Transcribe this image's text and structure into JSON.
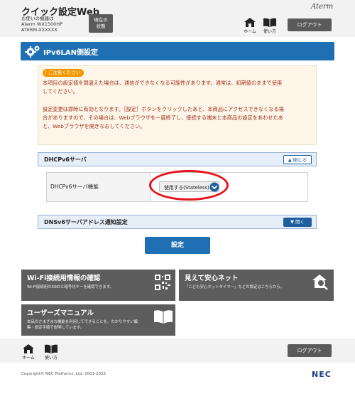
{
  "header": {
    "app_title": "クイック設定Web",
    "device_label": "お使いの機器は",
    "device_model": "Aterm WX1500HP",
    "device_name": "ATERM-XXXXXX",
    "status_button": [
      "現在の",
      "状態"
    ],
    "brand": "Aterm",
    "nav": {
      "home": "ホーム",
      "manual": "使い方"
    },
    "logout": "ログアウト"
  },
  "page": {
    "title": "IPv6LAN側設定"
  },
  "caution": {
    "badge": "ご注意ください",
    "lines": [
      "本項目の設定値を間違えた場合は、通信ができなくなる可能性があります。通常は、初期値のままで使用",
      "してください。",
      "",
      "設定変更は即時に有効となります。［設定］ボタンをクリックしたあと、本商品にアクセスできなくなる場",
      "合がありますので、その場合は、Webブラウザを一度終了し、接続する端末と本商品の設定をあわせたあ",
      "と、Webブラウザを開きなおしてください。"
    ]
  },
  "dhcp_section": {
    "title": "DHCPv6サーバ",
    "toggle": "閉じる",
    "row_label": "DHCPv6サーバ機能",
    "select_value": "使用する(Stateless)"
  },
  "dns_section": {
    "title": "DNSv6サーバアドレス通知設定",
    "toggle": "開く"
  },
  "apply_button": "設定",
  "cards": {
    "wifi": {
      "title": "Wi-Fi接続用情報の確認",
      "desc": "Wi-Fi接続用のSSIDと暗号化キーを確認できます。"
    },
    "safety": {
      "title": "見えて安心ネット",
      "desc": "「こども安心ネットタイマー」などの設定はこちらから。"
    },
    "manual": {
      "title": "ユーザーズマニュアル",
      "desc_lines": [
        "本品のさまざまな機能を利用してできることを、わかりやすい編",
        "集・設定手順で説明しています。"
      ]
    }
  },
  "footer": {
    "nav": {
      "home": "ホーム",
      "manual": "使い方"
    },
    "logout": "ログアウト",
    "copyright": "Copyright© NEC Platforms, Ltd. 2001-2022",
    "brand": "NEC"
  },
  "colors": {
    "primary_blue": "#1f6fb5",
    "caution_red": "#a0301e",
    "caution_orange": "#f39800",
    "highlight_red": "#e8121b",
    "card_gray": "#5d5d5d"
  },
  "icons": [
    "home-icon",
    "book-icon",
    "gear-icon",
    "qr-code-icon",
    "house-search-icon",
    "chevron-down-icon",
    "chevron-up-icon"
  ]
}
